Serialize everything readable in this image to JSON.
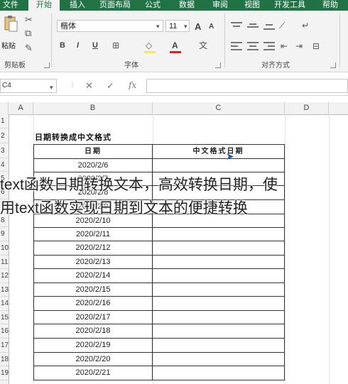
{
  "ribbon": {
    "tabs": [
      {
        "label": "文件",
        "active": false
      },
      {
        "label": "开始",
        "active": true
      },
      {
        "label": "插入",
        "active": false
      },
      {
        "label": "页面布局",
        "active": false
      },
      {
        "label": "公式",
        "active": false
      },
      {
        "label": "数据",
        "active": false
      },
      {
        "label": "审阅",
        "active": false
      },
      {
        "label": "视图",
        "active": false
      },
      {
        "label": "开发工具",
        "active": false
      },
      {
        "label": "帮助",
        "active": false
      }
    ],
    "clipboard": {
      "paste_label": "粘贴",
      "group_label": "剪贴板"
    },
    "font": {
      "name": "楷体",
      "size": "11",
      "group_label": "字体",
      "bold": "B",
      "italic": "I",
      "underline": "U",
      "grow": "A",
      "shrink": "A",
      "color_letter": "A"
    },
    "alignment": {
      "group_label": "对齐方式"
    }
  },
  "formula_bar": {
    "name_box": "C4",
    "cancel": "✕",
    "enter": "✓",
    "fx": "fx",
    "value": ""
  },
  "columns": [
    "A",
    "B",
    "C",
    "D"
  ],
  "rows": [
    "1",
    "2",
    "3",
    "4",
    "5",
    "6",
    "7",
    "8",
    "9",
    "10",
    "11",
    "12",
    "13",
    "14",
    "15",
    "16",
    "17",
    "18",
    "19"
  ],
  "sheet": {
    "title": "日期转换成中文格式",
    "col_b_header": "日期",
    "col_c_header": "中文格式日期",
    "dates": [
      "2020/2/6",
      "2020/2/7",
      "2020/2/8",
      "2020/2/9",
      "2020/2/10",
      "2020/2/11",
      "2020/2/12",
      "2020/2/13",
      "2020/2/14",
      "2020/2/15",
      "2020/2/16",
      "2020/2/17",
      "2020/2/18",
      "2020/2/19",
      "2020/2/20",
      "2020/2/21"
    ]
  },
  "caption": {
    "line1": "text函数日期转换文本，高效转换日期，使",
    "line2": "用text函数实现日期到文本的便捷转换"
  },
  "colors": {
    "ribbon_green": "#217346",
    "grid_border": "#333333"
  }
}
